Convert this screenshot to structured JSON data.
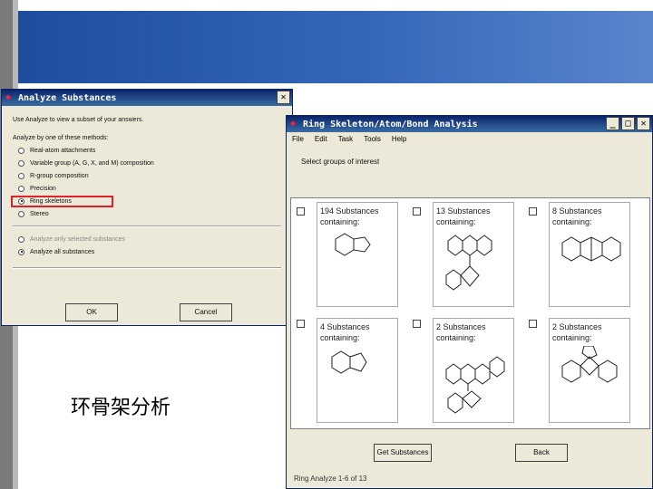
{
  "slide": {
    "caption": "环骨架分析"
  },
  "analyze_dialog": {
    "title": "Analyze Substances",
    "intro": "Use Analyze to view a subset of your answers.",
    "methods_label": "Analyze by one of these methods:",
    "methods": [
      "Real-atom attachments",
      "Variable group (A, G, X, and M) composition",
      "R-group composition",
      "Precision",
      "Ring skeletons",
      "Stereo"
    ],
    "selected_method": "Ring skeletons",
    "scope_options": [
      "Analyze only selected substances",
      "Analyze all substances"
    ],
    "selected_scope": "Analyze all substances",
    "ok_label": "OK",
    "cancel_label": "Cancel"
  },
  "ring_window": {
    "title": "Ring Skeleton/Atom/Bond Analysis",
    "menu": [
      "File",
      "Edit",
      "Task",
      "Tools",
      "Help"
    ],
    "prompt": "Select groups of interest",
    "results": [
      {
        "line1": "194 Substances",
        "line2": "containing:"
      },
      {
        "line1": "13 Substances",
        "line2": "containing:"
      },
      {
        "line1": "8 Substances",
        "line2": "containing:"
      },
      {
        "line1": "4 Substances",
        "line2": "containing:"
      },
      {
        "line1": "2 Substances",
        "line2": "containing:"
      },
      {
        "line1": "2 Substances",
        "line2": "containing:"
      }
    ],
    "get_substances_label": "Get Substances",
    "back_label": "Back",
    "status": "Ring Analyze 1-6 of 13"
  }
}
